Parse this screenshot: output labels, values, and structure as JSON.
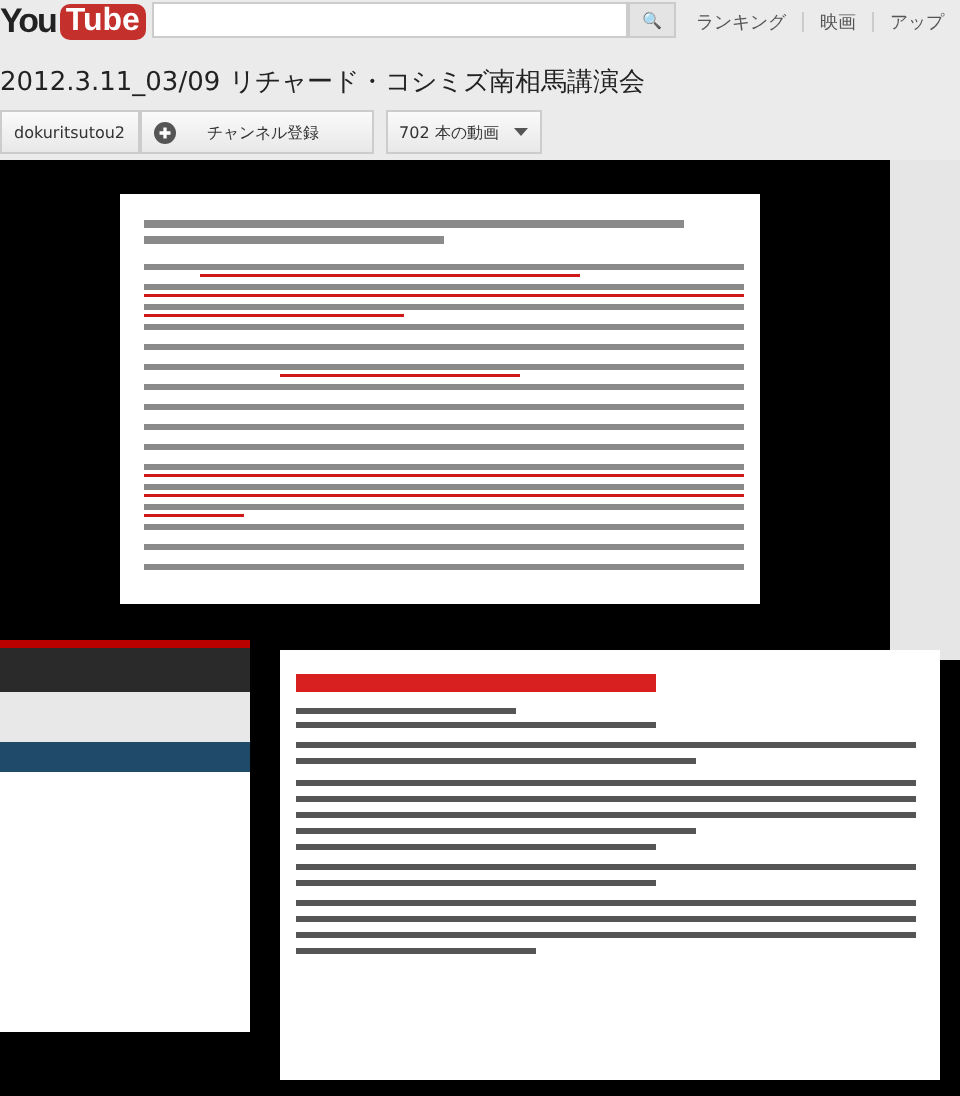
{
  "logo": {
    "left": "You",
    "right": "Tube"
  },
  "search": {
    "button": "🔍"
  },
  "nav": [
    "ランキング",
    "映画",
    "アップ"
  ],
  "video_title": "2012.3.11_03/09 リチャード・コシミズ南相馬講演会",
  "channel": {
    "name": "dokuritsutou2",
    "subscribe": "チャンネル登録",
    "videos": "702 本の動画"
  }
}
